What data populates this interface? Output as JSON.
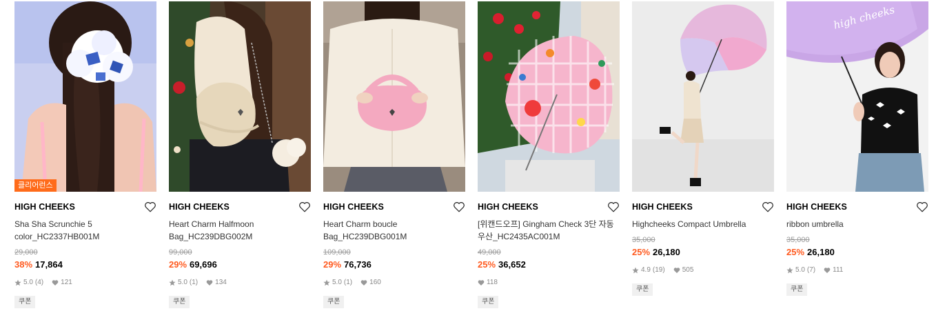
{
  "products": [
    {
      "badge": "클리어런스",
      "brand": "HIGH CHEEKS",
      "name": "Sha Sha Scrunchie 5 color_HC2337HB001M",
      "original_price": "29,000",
      "discount": "38%",
      "price": "17,864",
      "rating": "5.0",
      "reviews": "(4)",
      "likes": "121",
      "coupon": "쿠폰"
    },
    {
      "brand": "HIGH CHEEKS",
      "name": "Heart Charm Halfmoon Bag_HC239DBG002M",
      "original_price": "99,000",
      "discount": "29%",
      "price": "69,696",
      "rating": "5.0",
      "reviews": "(1)",
      "likes": "134",
      "coupon": "쿠폰"
    },
    {
      "brand": "HIGH CHEEKS",
      "name": "Heart Charm boucle Bag_HC239DBG001M",
      "original_price": "109,000",
      "discount": "29%",
      "price": "76,736",
      "rating": "5.0",
      "reviews": "(1)",
      "likes": "160",
      "coupon": "쿠폰"
    },
    {
      "brand": "HIGH CHEEKS",
      "name": "[위캔드오프] Gingham Check 3단 자동 우산_HC2435AC001M",
      "original_price": "49,000",
      "discount": "25%",
      "price": "36,652",
      "likes": "118",
      "coupon": "쿠폰"
    },
    {
      "brand": "HIGH CHEEKS",
      "name": "Highcheeks Compact Umbrella",
      "original_price": "35,000",
      "discount": "25%",
      "price": "26,180",
      "rating": "4.9",
      "reviews": "(19)",
      "likes": "505",
      "coupon": "쿠폰"
    },
    {
      "brand": "HIGH CHEEKS",
      "name": "ribbon umbrella",
      "original_price": "35,000",
      "discount": "25%",
      "price": "26,180",
      "rating": "5.0",
      "reviews": "(7)",
      "likes": "111",
      "coupon": "쿠폰",
      "umbrella_text": "high cheeks"
    }
  ],
  "colors": {
    "accent": "#ff5a1f",
    "badge": "#ff6b1a"
  }
}
